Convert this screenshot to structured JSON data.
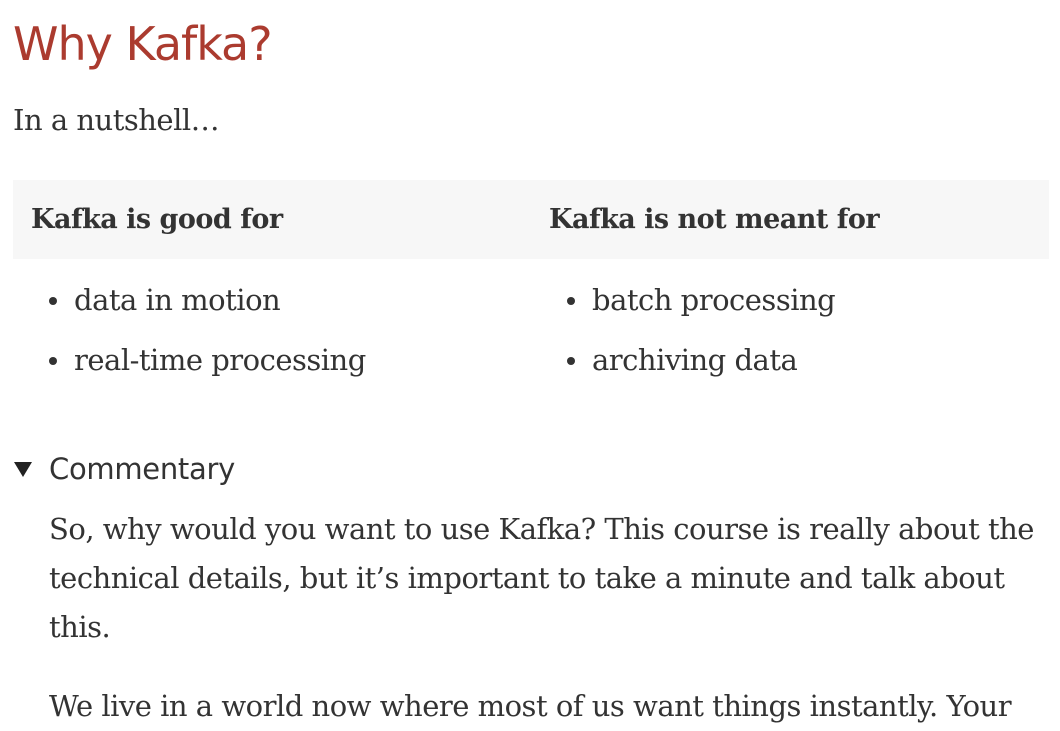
{
  "page": {
    "title": "Why Kafka?",
    "lead": "In a nutshell…"
  },
  "comparison": {
    "headers": [
      "Kafka is good for",
      "Kafka is not meant for"
    ],
    "good_for": [
      "data in motion",
      "real-time processing"
    ],
    "not_meant_for": [
      "batch processing",
      "archiving data"
    ]
  },
  "commentary": {
    "label": "Commentary",
    "expanded": true,
    "paragraphs": [
      "So, why would you want to use Kafka? This course is really about the technical details, but it’s important to take a minute and talk about this.",
      "We live in a world now where most of us want things instantly. Your"
    ]
  },
  "colors": {
    "title": "#ab3b2f",
    "text": "#333333",
    "table_header_bg": "#f7f7f7"
  },
  "icons": {
    "commentary_toggle": "triangle-down-icon",
    "bullet": "bullet-dot-icon"
  }
}
